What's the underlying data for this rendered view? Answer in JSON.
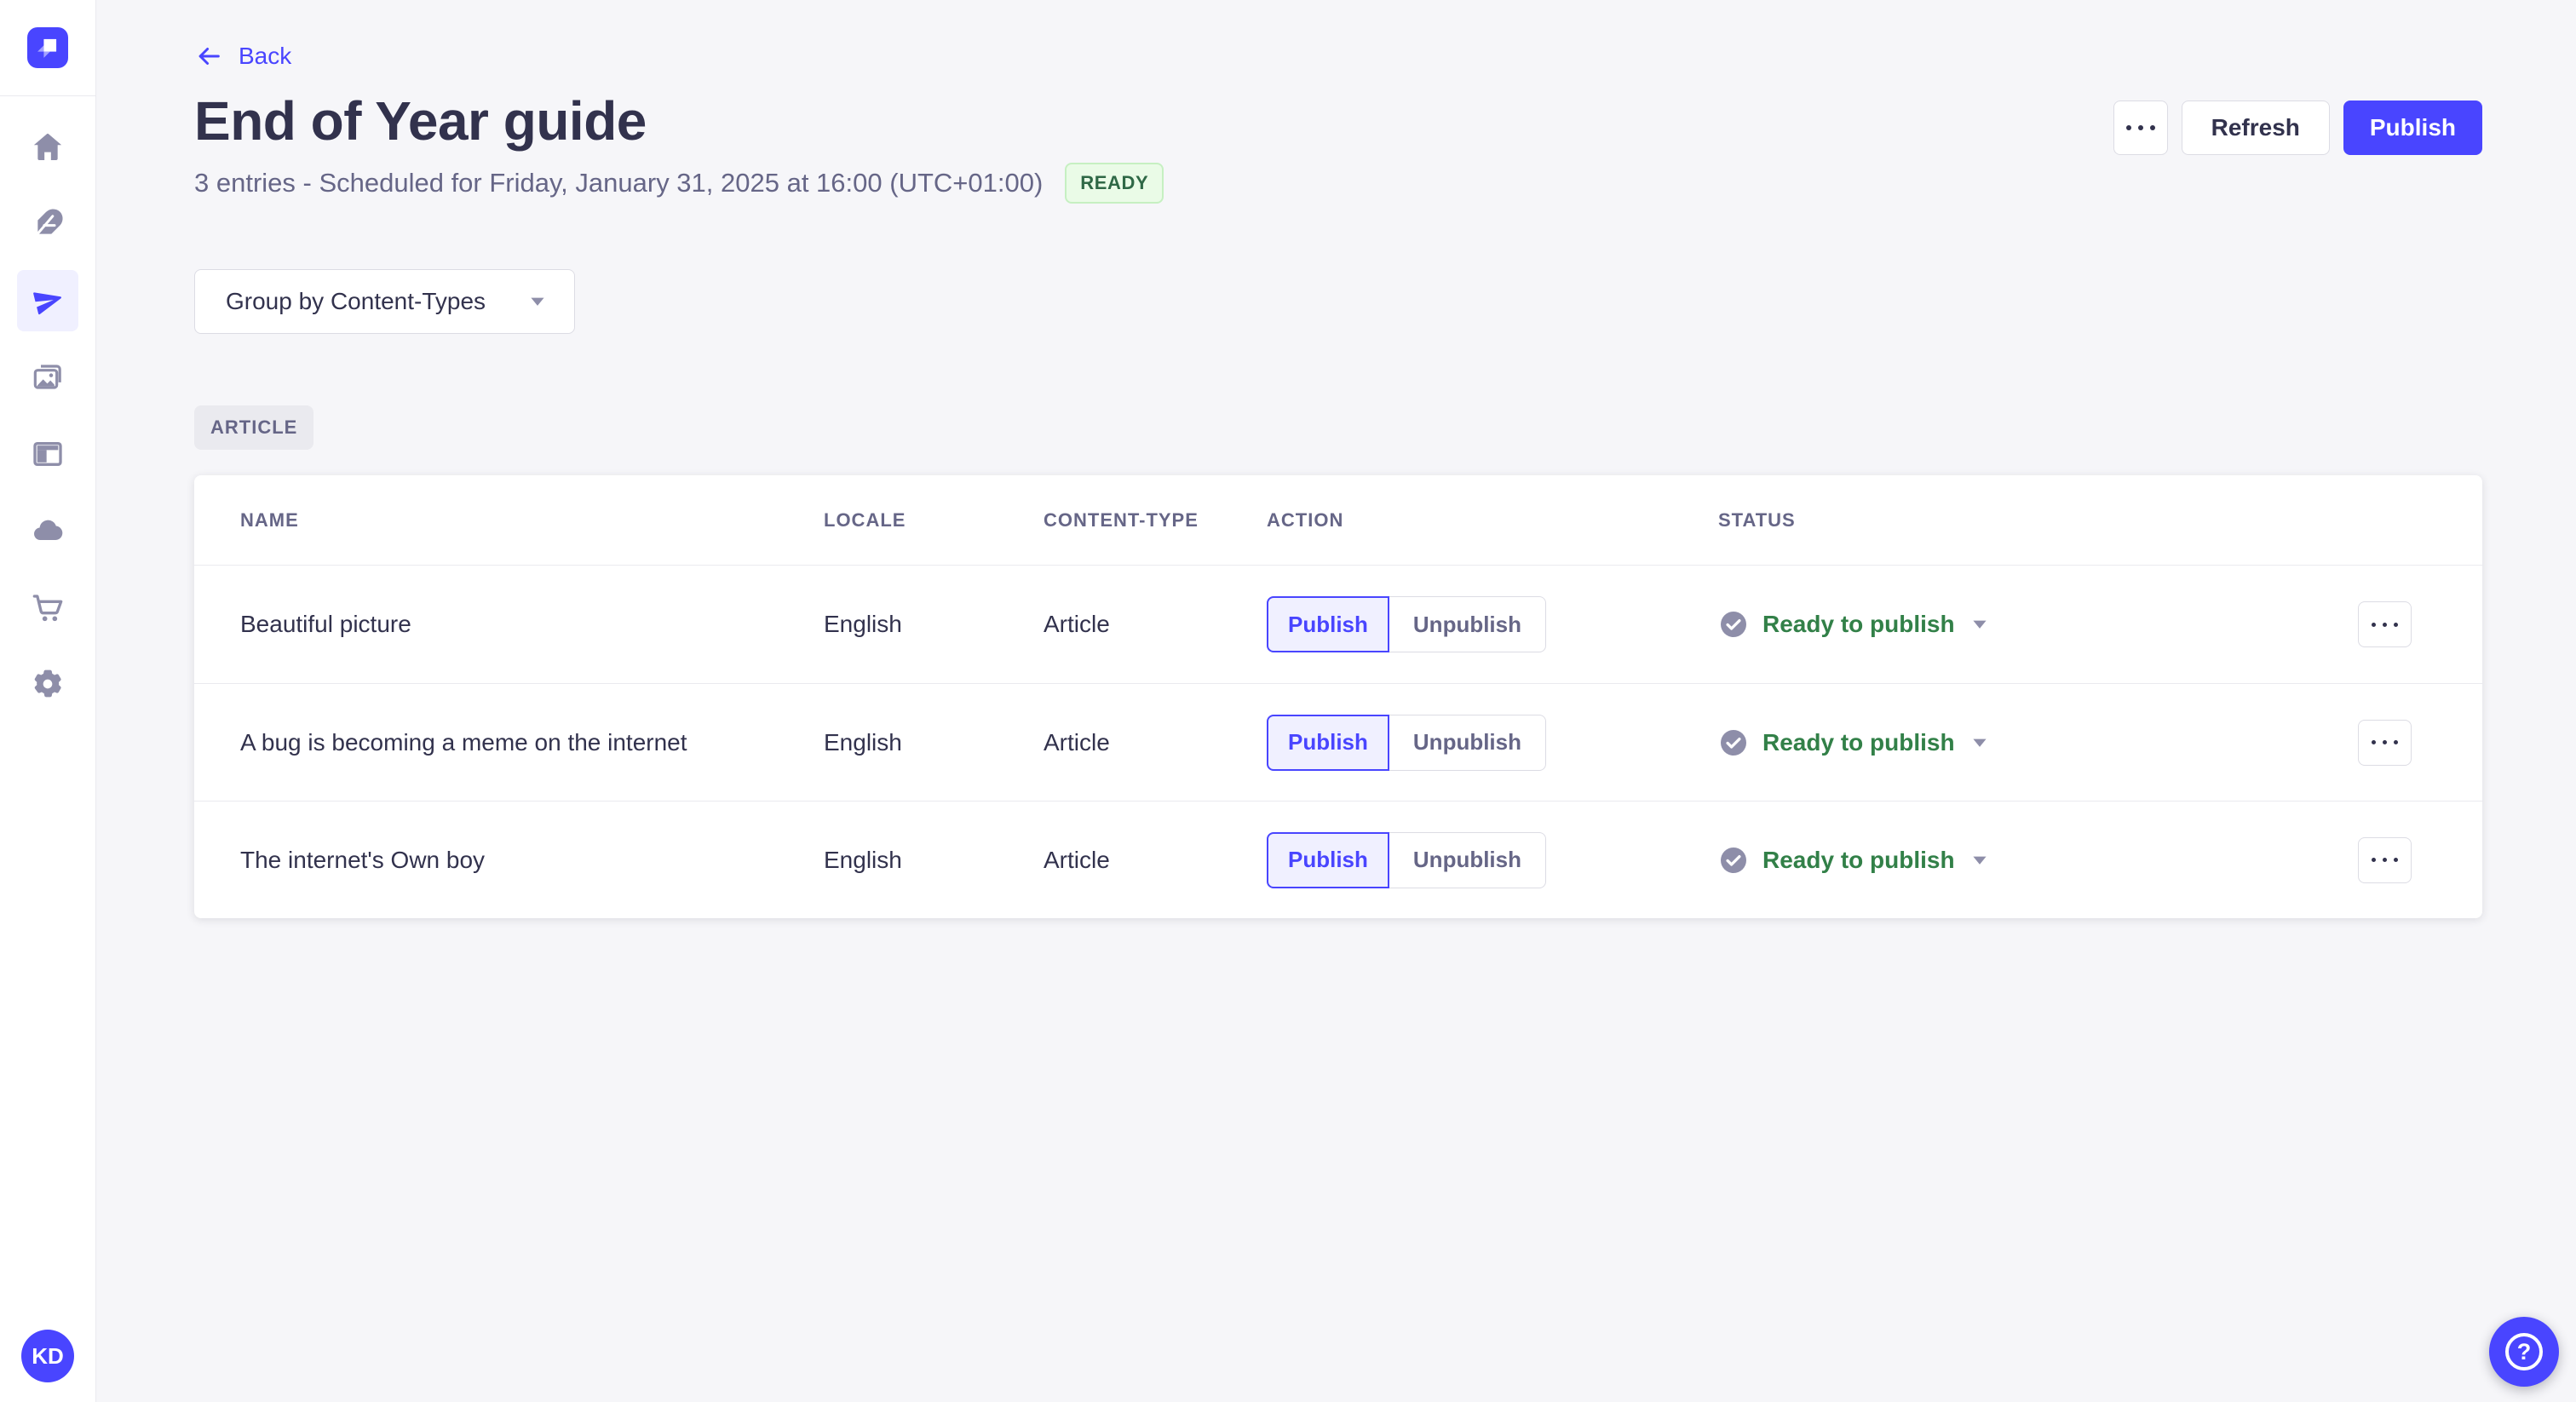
{
  "colors": {
    "accent": "#4945ff",
    "accent_light": "#f0f0ff",
    "text_dark": "#32324d",
    "text_muted": "#666687",
    "icon_muted": "#8e8ea9",
    "border": "#dcdce4",
    "divider": "#eaeaef",
    "page_bg": "#f6f6f9",
    "success_text": "#328048",
    "success_bg": "#eafbe7",
    "success_border": "#c6f0c2"
  },
  "sidebar": {
    "logo_icon": "strapi-logo",
    "items": [
      {
        "icon": "home-icon",
        "active": false
      },
      {
        "icon": "feather-icon",
        "active": false
      },
      {
        "icon": "paper-plane-icon",
        "active": true
      },
      {
        "icon": "media-library-icon",
        "active": false
      },
      {
        "icon": "layout-icon",
        "active": false
      },
      {
        "icon": "cloud-icon",
        "active": false
      },
      {
        "icon": "cart-icon",
        "active": false
      },
      {
        "icon": "gear-icon",
        "active": false
      }
    ],
    "avatar_initials": "KD"
  },
  "header": {
    "back_label": "Back",
    "title": "End of Year guide",
    "subtitle": "3 entries - Scheduled for Friday, January 31, 2025 at 16:00 (UTC+01:00)",
    "status_badge": "READY",
    "refresh_label": "Refresh",
    "publish_label": "Publish"
  },
  "toolbar": {
    "group_by_label": "Group by Content-Types"
  },
  "content": {
    "group_badge": "ARTICLE"
  },
  "table": {
    "columns": [
      "NAME",
      "LOCALE",
      "CONTENT-TYPE",
      "ACTION",
      "STATUS"
    ],
    "rows": [
      {
        "name": "Beautiful picture",
        "locale": "English",
        "content_type": "Article",
        "publish_label": "Publish",
        "unpublish_label": "Unpublish",
        "status": "Ready to publish"
      },
      {
        "name": "A bug is becoming a meme on the internet",
        "locale": "English",
        "content_type": "Article",
        "publish_label": "Publish",
        "unpublish_label": "Unpublish",
        "status": "Ready to publish"
      },
      {
        "name": "The internet's Own boy",
        "locale": "English",
        "content_type": "Article",
        "publish_label": "Publish",
        "unpublish_label": "Unpublish",
        "status": "Ready to publish"
      }
    ]
  },
  "help": {
    "label": "?"
  }
}
